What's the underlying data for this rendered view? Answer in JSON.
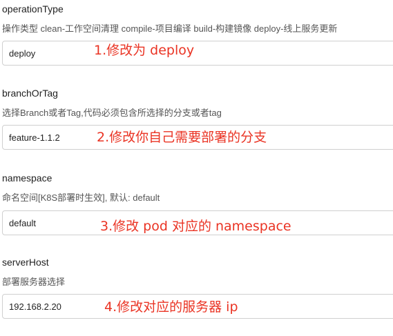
{
  "params": [
    {
      "name": "operationType",
      "description": "操作类型 clean-工作空间清理 compile-项目编译 build-构建镜像 deploy-线上服务更新",
      "value": "deploy",
      "annotation": "1.修改为 deploy"
    },
    {
      "name": "branchOrTag",
      "description": "选择Branch或者Tag,代码必须包含所选择的分支或者tag",
      "value": "feature-1.1.2",
      "annotation": "2.修改你自己需要部署的分支"
    },
    {
      "name": "namespace",
      "description": "命名空间[K8S部署时生效], 默认: default",
      "value": "default",
      "annotation": "3.修改 pod 对应的 namespace"
    },
    {
      "name": "serverHost",
      "description": "部署服务器选择",
      "value": "192.168.2.20",
      "annotation": "4.修改对应的服务器 ip"
    }
  ],
  "colors": {
    "annotation": "#ea3323",
    "input_border": "#cfcfcf"
  }
}
